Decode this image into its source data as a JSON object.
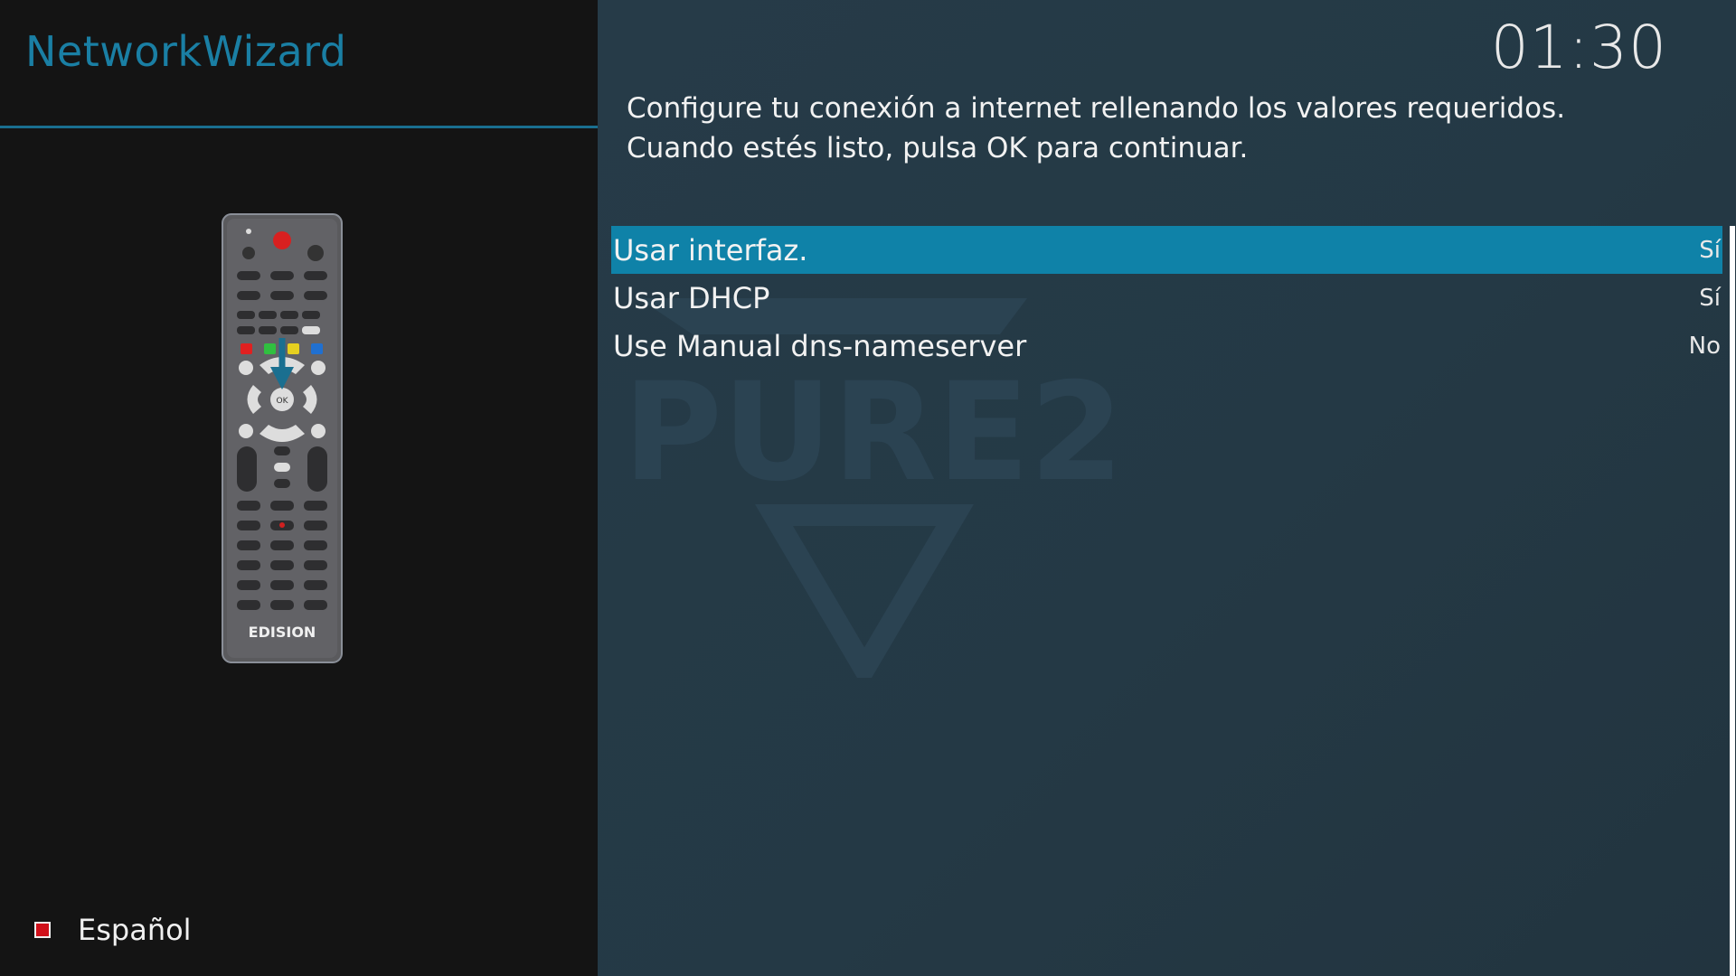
{
  "app": {
    "title": "NetworkWizard"
  },
  "remote": {
    "brand": "EDISION",
    "ok_label": "OK"
  },
  "language": {
    "label": "Español",
    "indicator_color": "#d0101a"
  },
  "watermark": {
    "text": "PURE2"
  },
  "clock": {
    "time": "01:30"
  },
  "description": {
    "line1": "Configure tu conexión a internet rellenando los valores requeridos.",
    "line2": "Cuando estés listo, pulsa OK para continuar."
  },
  "settings": {
    "items": [
      {
        "label": "Usar interfaz.",
        "value": "Sí",
        "selected": true
      },
      {
        "label": "Usar DHCP",
        "value": "Sí",
        "selected": false
      },
      {
        "label": "Use Manual dns-nameserver",
        "value": "No",
        "selected": false
      }
    ]
  },
  "colors": {
    "accent": "#1a7fa4",
    "selection": "#0f82a8",
    "left_bg": "#141414",
    "right_bg": "#263b48"
  }
}
